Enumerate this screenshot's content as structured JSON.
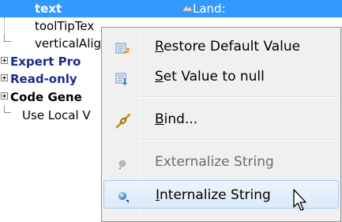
{
  "tree": {
    "rows": [
      {
        "name": "text",
        "value": "Land:",
        "selected": true
      },
      {
        "name": "toolTipTex"
      },
      {
        "name": "verticalAlig"
      },
      {
        "name": "Expert Pro"
      },
      {
        "name": "Read-only"
      },
      {
        "name": "Code Gene"
      },
      {
        "name": "Use Local V"
      }
    ]
  },
  "menu": {
    "items": [
      {
        "mnemonic": "R",
        "rest": "estore Default Value",
        "icon": "restore-default-icon",
        "enabled": true
      },
      {
        "mnemonic": "S",
        "rest": "et Value to null",
        "icon": "set-null-icon",
        "enabled": true
      },
      {
        "mnemonic": "B",
        "rest": "ind...",
        "icon": "bind-icon",
        "enabled": true
      },
      {
        "mnemonic": "",
        "rest": "Externalize String",
        "icon": "externalize-string-icon",
        "enabled": false
      },
      {
        "mnemonic": "I",
        "rest": "nternalize String",
        "icon": "internalize-string-icon",
        "enabled": true,
        "highlighted": true
      }
    ]
  },
  "colors": {
    "selection": "#3399ff",
    "category_text": "#1a2a8c",
    "menu_background": "#f0f0f0"
  }
}
